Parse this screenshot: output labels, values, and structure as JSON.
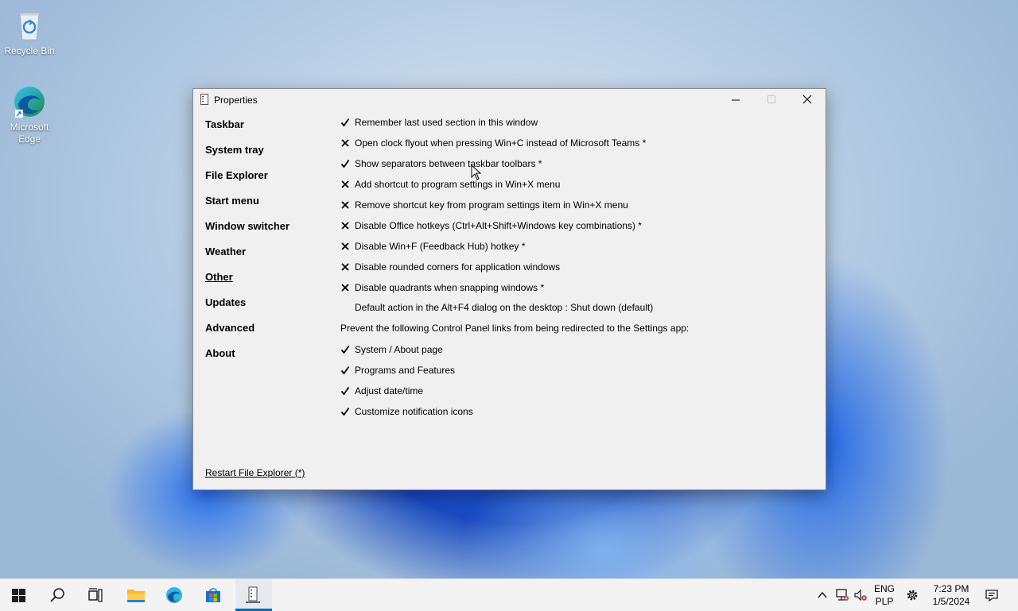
{
  "desktop": {
    "icons": [
      {
        "label": "Recycle Bin",
        "icon": "recycle-bin-icon"
      },
      {
        "label": "Microsoft Edge",
        "icon": "edge-icon"
      }
    ]
  },
  "window": {
    "title": "Properties",
    "icon": "properties-app-icon",
    "controls": {
      "minimize": "minimize-icon",
      "maximize": "maximize-icon",
      "close": "close-icon"
    }
  },
  "nav": {
    "items": [
      {
        "label": "Taskbar"
      },
      {
        "label": "System tray"
      },
      {
        "label": "File Explorer"
      },
      {
        "label": "Start menu"
      },
      {
        "label": "Window switcher"
      },
      {
        "label": "Weather"
      },
      {
        "label": "Other",
        "selected": true
      },
      {
        "label": "Updates"
      },
      {
        "label": "Advanced"
      },
      {
        "label": "About"
      }
    ]
  },
  "options": [
    {
      "label": "Remember last used section in this window",
      "state": "checked"
    },
    {
      "label": "Open clock flyout when pressing Win+C instead of Microsoft Teams *",
      "state": "unchecked"
    },
    {
      "label": "Show separators between taskbar toolbars *",
      "state": "checked"
    },
    {
      "label": "Add shortcut to program settings in Win+X menu",
      "state": "unchecked"
    },
    {
      "label": "Remove shortcut key from program settings item in Win+X menu",
      "state": "unchecked"
    },
    {
      "label": "Disable Office hotkeys (Ctrl+Alt+Shift+Windows key combinations) *",
      "state": "unchecked"
    },
    {
      "label": "Disable Win+F (Feedback Hub) hotkey *",
      "state": "unchecked"
    },
    {
      "label": "Disable rounded corners for application windows",
      "state": "unchecked"
    },
    {
      "label": "Disable quadrants when snapping windows *",
      "state": "unchecked"
    }
  ],
  "alt_f4_setting": "Default action in the Alt+F4 dialog on the desktop : Shut down (default)",
  "control_panel_heading": "Prevent the following Control Panel links from being redirected to the Settings app:",
  "control_panel_options": [
    {
      "label": "System / About page",
      "state": "checked"
    },
    {
      "label": "Programs and Features",
      "state": "checked"
    },
    {
      "label": "Adjust date/time",
      "state": "checked"
    },
    {
      "label": "Customize notification icons",
      "state": "checked"
    }
  ],
  "restart_link": "Restart File Explorer (*)",
  "taskbar": {
    "items": [
      "start-icon",
      "search-icon",
      "task-view-icon",
      "file-explorer-icon",
      "edge-icon",
      "store-icon",
      "properties-app-icon"
    ],
    "active_item": "properties-app-icon",
    "tray": {
      "language": "ENG",
      "layout": "PLP",
      "time": "7:23 PM",
      "date": "1/5/2024"
    },
    "accent": "#0067c0"
  }
}
